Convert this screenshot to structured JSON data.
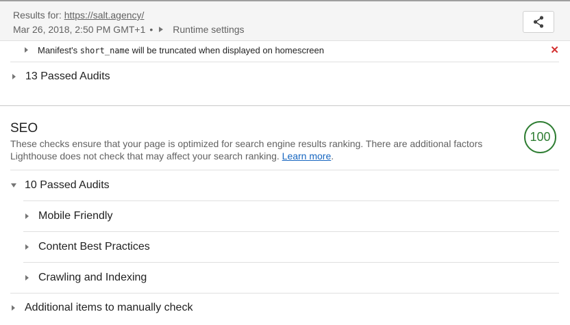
{
  "header": {
    "results_prefix": "Results for:",
    "url": "https://salt.agency/",
    "timestamp": "Mar 26, 2018, 2:50 PM GMT+1",
    "bullet": "•",
    "runtime_settings": "Runtime settings",
    "share_icon": "share-icon"
  },
  "pwa": {
    "manifest_audit": {
      "prefix": "Manifest's ",
      "code": "short_name",
      "suffix": " will be truncated when displayed on homescreen",
      "status_icon": "✕",
      "status_color": "#d32f2f"
    },
    "passed_audits": "13 Passed Audits"
  },
  "seo": {
    "title": "SEO",
    "description": "These checks ensure that your page is optimized for search engine results ranking. There are additional factors Lighthouse does not check that may affect your search ranking.",
    "learn_more": "Learn more",
    "period": ".",
    "score": "100",
    "score_color": "#2e7d32",
    "passed_audits": "10 Passed Audits",
    "groups": [
      {
        "label": "Mobile Friendly"
      },
      {
        "label": "Content Best Practices"
      },
      {
        "label": "Crawling and Indexing"
      }
    ],
    "additional": "Additional items to manually check"
  }
}
